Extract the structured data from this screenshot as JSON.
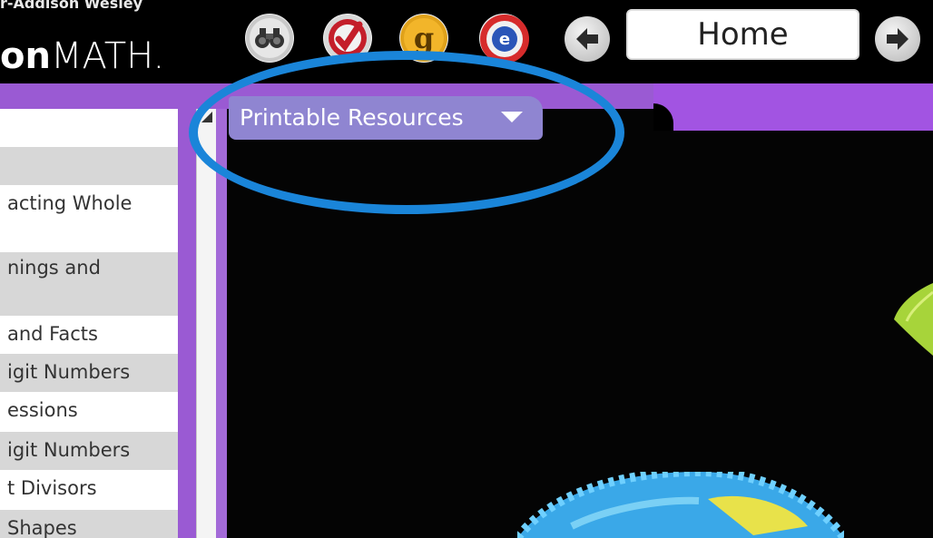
{
  "header": {
    "publisher_text": "r-Addison Wesley",
    "brand_bold": "on",
    "brand_light": "MATH.",
    "tools": [
      {
        "icon": "binoculars-icon"
      },
      {
        "icon": "checkmark-icon"
      },
      {
        "icon": "glossary-g-icon"
      },
      {
        "icon": "e-tools-icon"
      }
    ],
    "nav": {
      "back_icon": "arrow-left-icon",
      "forward_icon": "arrow-right-icon",
      "location_value": "Home"
    }
  },
  "tab": {
    "label": "Printable Resources",
    "dropdown_icon": "chevron-down-icon"
  },
  "sidebar": {
    "items": [
      {
        "label": ""
      },
      {
        "label": ""
      },
      {
        "label": "acting Whole"
      },
      {
        "label": ""
      },
      {
        "label": "nings and"
      },
      {
        "label": ""
      },
      {
        "label": " and Facts"
      },
      {
        "label": "igit Numbers"
      },
      {
        "label": "essions"
      },
      {
        "label": "igit Numbers"
      },
      {
        "label": "t Divisors"
      },
      {
        "label": "Shapes"
      }
    ]
  },
  "colors": {
    "accent_purple": "#9a5ad3",
    "tab_purple": "#8f85d1",
    "highlight_blue": "#1a85d9"
  }
}
